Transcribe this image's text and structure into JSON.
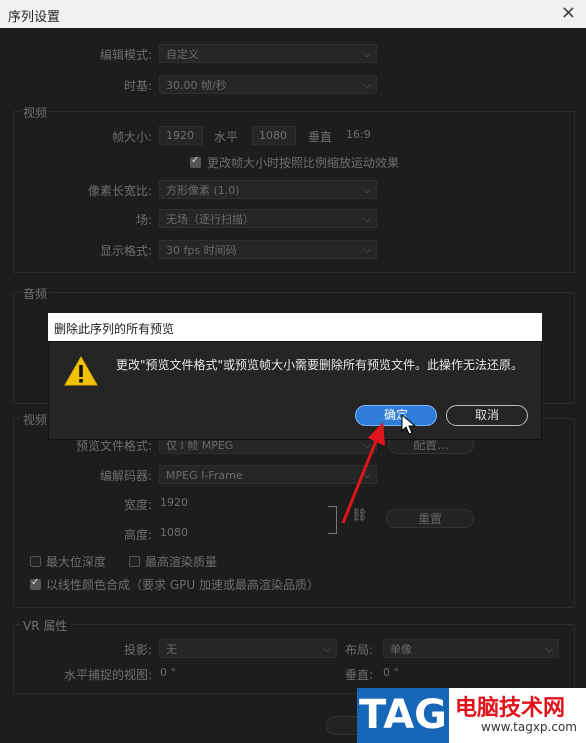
{
  "window": {
    "title": "序列设置",
    "close": "×"
  },
  "settings": {
    "edit_mode_label": "编辑模式:",
    "edit_mode_value": "自定义",
    "timebase_label": "时基:",
    "timebase_value": "30.00  帧/秒",
    "video_group": "视频",
    "frame_size_label": "帧大小:",
    "frame_w": "1920",
    "horizontal_label": "水平",
    "frame_h": "1080",
    "vertical_label": "垂直",
    "aspect": "16:9",
    "scale_checkbox": "更改帧大小时按照比例缩放运动效果",
    "pixel_aspect_label": "像素长宽比:",
    "pixel_aspect_value": "方形像素 (1.0)",
    "field_label": "场:",
    "field_value": "无场（逐行扫描）",
    "display_format_label": "显示格式:",
    "display_format_value": "30 fps 时间码",
    "audio_group": "音频",
    "preview_group": "视频",
    "preview_format_label": "预览文件格式:",
    "preview_format_value": "仅 I 帧 MPEG",
    "config_button": "配置...",
    "codec_label": "编解码器:",
    "codec_value": "MPEG I-Frame",
    "width_label": "宽度:",
    "width_value": "1920",
    "height_label": "高度:",
    "height_value": "1080",
    "reset_button": "重置",
    "max_depth": "最大位深度",
    "max_quality": "最高渲染质量",
    "linear_color": "以线性颜色合成（要求 GPU 加速或最高渲染品质）",
    "vr_group": "VR 属性",
    "projection_label": "投影:",
    "projection_value": "无",
    "layout_label": "布局:",
    "layout_value": "单像",
    "hview_label": "水平捕捉的视图:",
    "hview_value": "0 °",
    "vview_label": "垂直:",
    "vview_value": "0 °"
  },
  "modal": {
    "title": "删除此序列的所有预览",
    "message": "更改\"预览文件格式\"或预览帧大小需要删除所有预览文件。此操作无法还原。",
    "ok": "确定",
    "cancel": "取消"
  },
  "watermark": {
    "tag": "TAG",
    "cn": "电脑技术网",
    "url": "www.tagxp.com"
  },
  "colors": {
    "accent": "#2f7dd8",
    "warning": "#f2c200",
    "arrow": "#e0141b"
  }
}
